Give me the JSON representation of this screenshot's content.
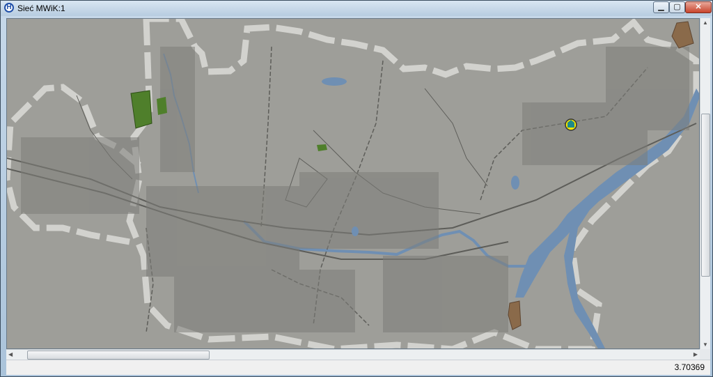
{
  "window": {
    "title": "Sieć MWiK:1",
    "app_icon_letter": "H",
    "minimize_glyph": "▁",
    "maximize_glyph": "▢",
    "close_glyph": "✕"
  },
  "map": {
    "background_color": "#9e9e99",
    "water_color": "#6f8fb3",
    "boundary_color": "#d2d2ce",
    "street_color": "#5d5d59",
    "green_area_color": "#4f7f2b",
    "brown_area_color": "#8a6a4a",
    "marker_color": "#f2e600",
    "marker_icon": "building-icon"
  },
  "scrollbars": {
    "left_arrow": "◀",
    "right_arrow": "▶",
    "up_arrow": "▲",
    "down_arrow": "▼"
  },
  "status": {
    "scale_value": "3.70369"
  }
}
